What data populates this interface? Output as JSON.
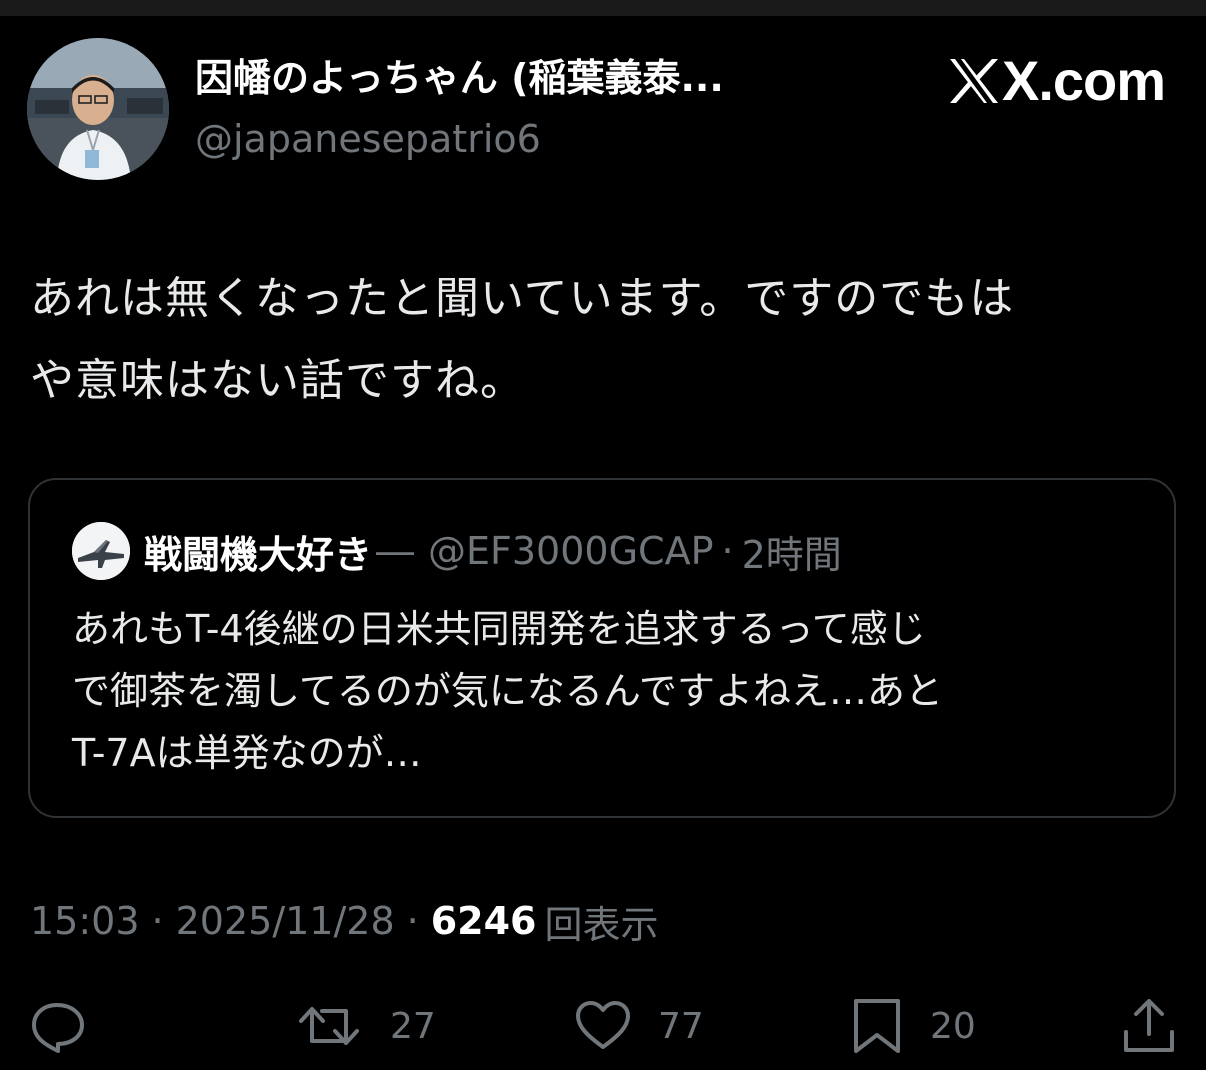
{
  "author": {
    "display_name": "因幡のよっちゃん (稲葉義泰...",
    "handle": "@japanesepatrio6"
  },
  "brand": {
    "text": "X.com",
    "icon": "x-logo-icon"
  },
  "tweet": {
    "lines": [
      "あれは無くなったと聞いています。ですのでもは",
      "や意味はない話ですね。"
    ]
  },
  "quote": {
    "display_name": "戦闘機大好き",
    "dash": "―",
    "handle": "@EF3000GCAP",
    "separator": "·",
    "time": "2時間",
    "lines": [
      "あれもT-4後継の日米共同開発を追求するって感じ",
      "で御茶を濁してるのが気になるんですよねえ…あと",
      "T-7Aは単発なのが…"
    ]
  },
  "meta": {
    "time": "15:03",
    "separator": "·",
    "date": "2025/11/28",
    "views_count": "6246",
    "views_label": "回表示"
  },
  "actions": {
    "reply": {
      "icon": "reply-icon"
    },
    "repost": {
      "icon": "repost-icon",
      "count": "27"
    },
    "like": {
      "icon": "heart-icon",
      "count": "77"
    },
    "bookmark": {
      "icon": "bookmark-icon",
      "count": "20"
    },
    "share": {
      "icon": "share-icon"
    }
  },
  "colors": {
    "background": "#000000",
    "text": "#e7e9ea",
    "secondary": "#71767b",
    "border": "#2f3336"
  }
}
